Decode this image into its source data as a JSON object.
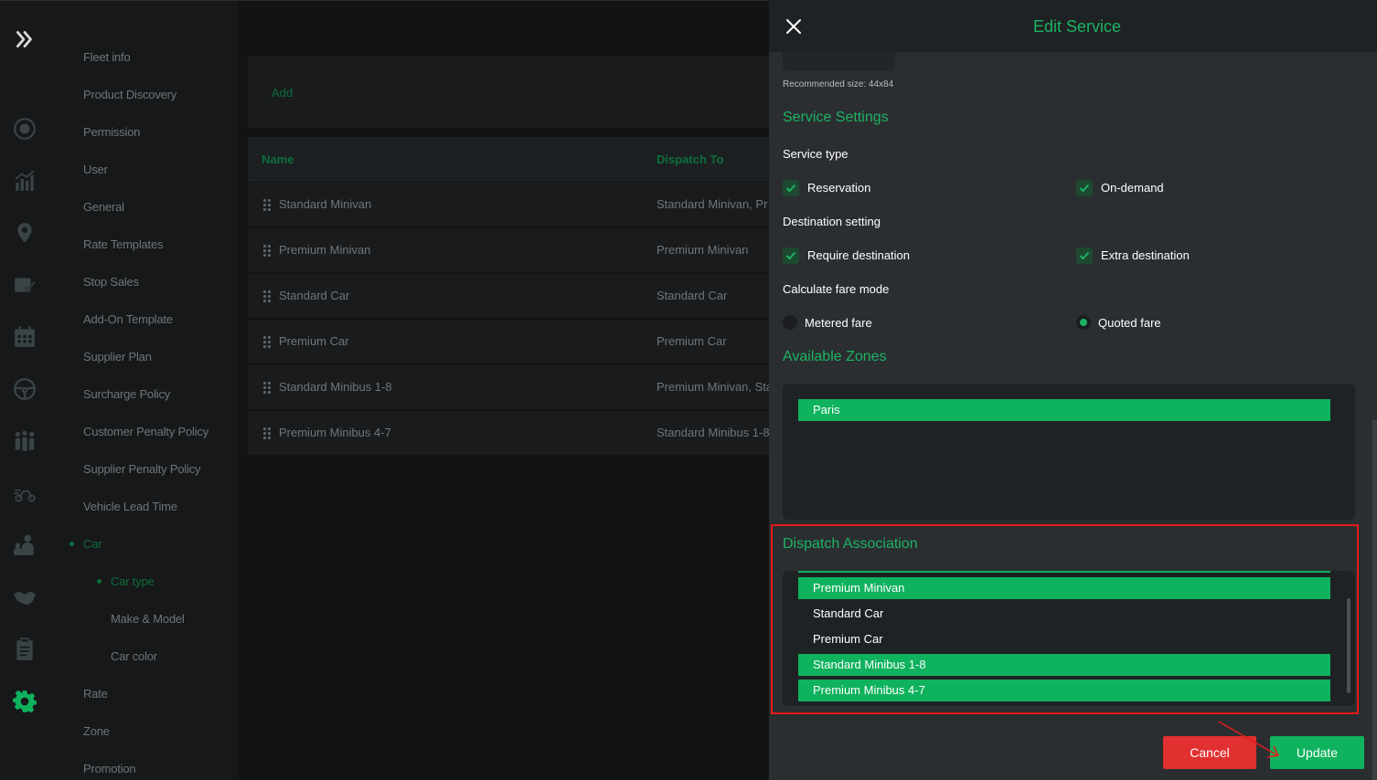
{
  "menu": {
    "items": [
      {
        "label": "Fleet info"
      },
      {
        "label": "Product Discovery"
      },
      {
        "label": "Permission"
      },
      {
        "label": "User"
      },
      {
        "label": "General"
      },
      {
        "label": "Rate Templates"
      },
      {
        "label": "Stop Sales"
      },
      {
        "label": "Add-On Template"
      },
      {
        "label": "Supplier Plan"
      },
      {
        "label": "Surcharge Policy"
      },
      {
        "label": "Customer Penalty Policy"
      },
      {
        "label": "Supplier Penalty Policy"
      },
      {
        "label": "Vehicle Lead Time"
      },
      {
        "label": "Car"
      },
      {
        "label": "Car type"
      },
      {
        "label": "Make & Model"
      },
      {
        "label": "Car color"
      },
      {
        "label": "Rate"
      },
      {
        "label": "Zone"
      },
      {
        "label": "Promotion"
      }
    ]
  },
  "main": {
    "add_label": "Add",
    "columns": [
      "Name",
      "Dispatch To"
    ],
    "rows": [
      {
        "name": "Standard Minivan",
        "dispatch": "Standard Minivan, Pr"
      },
      {
        "name": "Premium Minivan",
        "dispatch": "Premium Minivan"
      },
      {
        "name": "Standard Car",
        "dispatch": "Standard Car"
      },
      {
        "name": "Premium Car",
        "dispatch": "Premium Car"
      },
      {
        "name": "Standard Minibus 1-8",
        "dispatch": "Premium Minivan, Sta"
      },
      {
        "name": "Premium Minibus 4-7",
        "dispatch": "Standard Minibus 1-8"
      }
    ]
  },
  "panel": {
    "title": "Edit Service",
    "recommended_size": "Recommended size: 44x84",
    "service_settings_title": "Service Settings",
    "service_type_label": "Service type",
    "reservation_label": "Reservation",
    "on_demand_label": "On-demand",
    "destination_setting_label": "Destination setting",
    "require_destination_label": "Require destination",
    "extra_destination_label": "Extra destination",
    "fare_mode_label": "Calculate fare mode",
    "metered_fare_label": "Metered fare",
    "quoted_fare_label": "Quoted fare",
    "available_zones_title": "Available Zones",
    "zones": [
      {
        "label": "Paris",
        "selected": true
      }
    ],
    "dispatch_title": "Dispatch Association",
    "dispatch_items": [
      {
        "label": "Premium Minivan",
        "selected": true
      },
      {
        "label": "Standard Car",
        "selected": false
      },
      {
        "label": "Premium Car",
        "selected": false
      },
      {
        "label": "Standard Minibus 1-8",
        "selected": true
      },
      {
        "label": "Premium Minibus 4-7",
        "selected": true
      }
    ],
    "cancel_label": "Cancel",
    "update_label": "Update"
  },
  "colors": {
    "accent": "#1db363",
    "selected_fill": "#0fb25d",
    "cancel": "#e0302f",
    "highlight_frame": "#e31b1b"
  }
}
